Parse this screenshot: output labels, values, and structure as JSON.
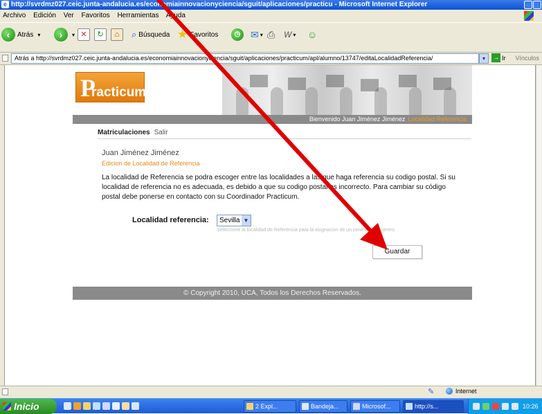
{
  "window": {
    "title": "http://svrdmz027.ceic.junta-andalucia.es/economiainnovacionyciencia/sguit/aplicaciones/practicu - Microsoft Internet Explorer"
  },
  "menu": [
    "Archivo",
    "Edición",
    "Ver",
    "Favoritos",
    "Herramientas",
    "Ayuda"
  ],
  "toolbar": {
    "back_label": "Atrás",
    "search_label": "Búsqueda",
    "favorites_label": "Favoritos"
  },
  "address": {
    "value": "Atrás a http://svrdmz027.ceic.junta-andalucia.es/economiainnovacionyciencia/sguit/aplicaciones/practicum/apl/alumno/13747/editaLocalidadReferencia/",
    "go_label": "Ir",
    "links_label": "Vínculos"
  },
  "page": {
    "logo_text": "racticum",
    "logo_letter": "P",
    "welcome": "Bienvenido Juan Jiménez Jiménez",
    "welcome_location": "Localidad Referencia",
    "nav": {
      "tab1": "Matriculaciones",
      "tab2": "Salir"
    },
    "user_name": "Juan Jiménez Jiménez",
    "subtitle": "Edicion de Localidad de Referencia",
    "info": "La localidad de Referencia se podra escoger entre las localidades a las que haga referencia su codigo postal. Si su localidad de referencia no es adecuada, es debido a que su codigo postal es incorrecto. Para cambiar su código postal debe ponerse en contacto con su Coordinador Practicum.",
    "locality_label": "Localidad referencia:",
    "locality_value": "Sevilla",
    "locality_hint": "Seleccione la localidad de Referencia para la asignacion de un centro de su centro.",
    "save_label": "Guardar",
    "footer": "© Copyright 2010, UCA, Todos los Derechos Reservados."
  },
  "status": {
    "zone": "Internet"
  },
  "taskbar": {
    "start_label": "Inicio",
    "tasks": [
      "2 Expl...",
      "Bandeja...",
      "Microsof...",
      "http://s..."
    ],
    "clock": "10:26"
  },
  "colors": {
    "accent_orange": "#f39a1e",
    "annotation_arrow": "#e00000",
    "banner_gray": "#8a8a8a"
  }
}
